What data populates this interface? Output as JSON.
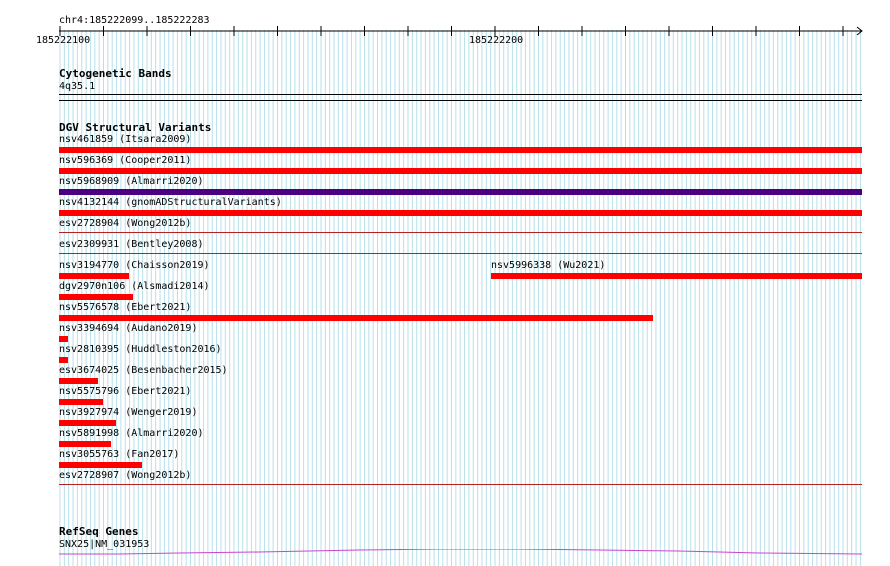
{
  "coords": {
    "region": "chr4:185222099..185222283",
    "ticks": [
      "185222100",
      "185222200"
    ]
  },
  "cytoband": {
    "title": "Cytogenetic Bands",
    "band": "4q35.1"
  },
  "dgv": {
    "title": "DGV Structural Variants",
    "colors": {
      "loss": "#ff0000",
      "gain_loss": "#4b0082",
      "separator": "#b22222"
    },
    "rows": [
      {
        "label": "nsv461859 (Itsara2009)",
        "color": "#ff0000",
        "start": 185222099,
        "end": 185222283,
        "bar": true
      },
      {
        "label": "nsv596369 (Cooper2011)",
        "color": "#ff0000",
        "start": 185222099,
        "end": 185222283,
        "bar": true
      },
      {
        "label": "nsv5968909 (Almarri2020)",
        "color": "#4b0082",
        "start": 185222099,
        "end": 185222283,
        "bar": true
      },
      {
        "label": "nsv4132144 (gnomADStructuralVariants)",
        "color": "#ff0000",
        "start": 185222099,
        "end": 185222283,
        "bar": true
      },
      {
        "label": "esv2728904 (Wong2012b)",
        "color": "#b22222",
        "start": 185222099,
        "end": 185222283,
        "bar": false
      },
      {
        "label": "esv2309931 (Bentley2008)",
        "color": "#b22222",
        "start": 185222099,
        "end": 185222283,
        "bar": false
      },
      {
        "label": "nsv3194770 (Chaisson2019)",
        "color": "#ff0000",
        "start": 185222099,
        "end": 185222115,
        "bar": true
      },
      {
        "label": "nsv5996338 (Wu2021)",
        "color": "#ff0000",
        "start": 185222198,
        "end": 185222283,
        "bar": true
      },
      {
        "label": "dgv2970n106 (Alsmadi2014)",
        "color": "#ff0000",
        "start": 185222099,
        "end": 185222116,
        "bar": true
      },
      {
        "label": "nsv5576578 (Ebert2021)",
        "color": "#ff0000",
        "start": 185222099,
        "end": 185222235,
        "bar": true
      },
      {
        "label": "nsv3394694 (Audano2019)",
        "color": "#ff0000",
        "start": 185222099,
        "end": 185222101,
        "bar": true
      },
      {
        "label": "nsv2810395 (Huddleston2016)",
        "color": "#ff0000",
        "start": 185222099,
        "end": 185222101,
        "bar": true
      },
      {
        "label": "esv3674025 (Besenbacher2015)",
        "color": "#ff0000",
        "start": 185222099,
        "end": 185222108,
        "bar": true
      },
      {
        "label": "nsv5575796 (Ebert2021)",
        "color": "#ff0000",
        "start": 185222099,
        "end": 185222109,
        "bar": true
      },
      {
        "label": "nsv3927974 (Wenger2019)",
        "color": "#ff0000",
        "start": 185222099,
        "end": 185222112,
        "bar": true
      },
      {
        "label": "nsv5891998 (Almarri2020)",
        "color": "#ff0000",
        "start": 185222099,
        "end": 185222111,
        "bar": true
      },
      {
        "label": "nsv3055763 (Fan2017)",
        "color": "#ff0000",
        "start": 185222099,
        "end": 185222118,
        "bar": true
      },
      {
        "label": "esv2728907 (Wong2012b)",
        "color": "#b22222",
        "start": 185222099,
        "end": 185222283,
        "bar": false
      }
    ]
  },
  "refseq": {
    "title": "RefSeq Genes",
    "gene": "SNX25|NM_031953",
    "color": "#cc44cc"
  }
}
